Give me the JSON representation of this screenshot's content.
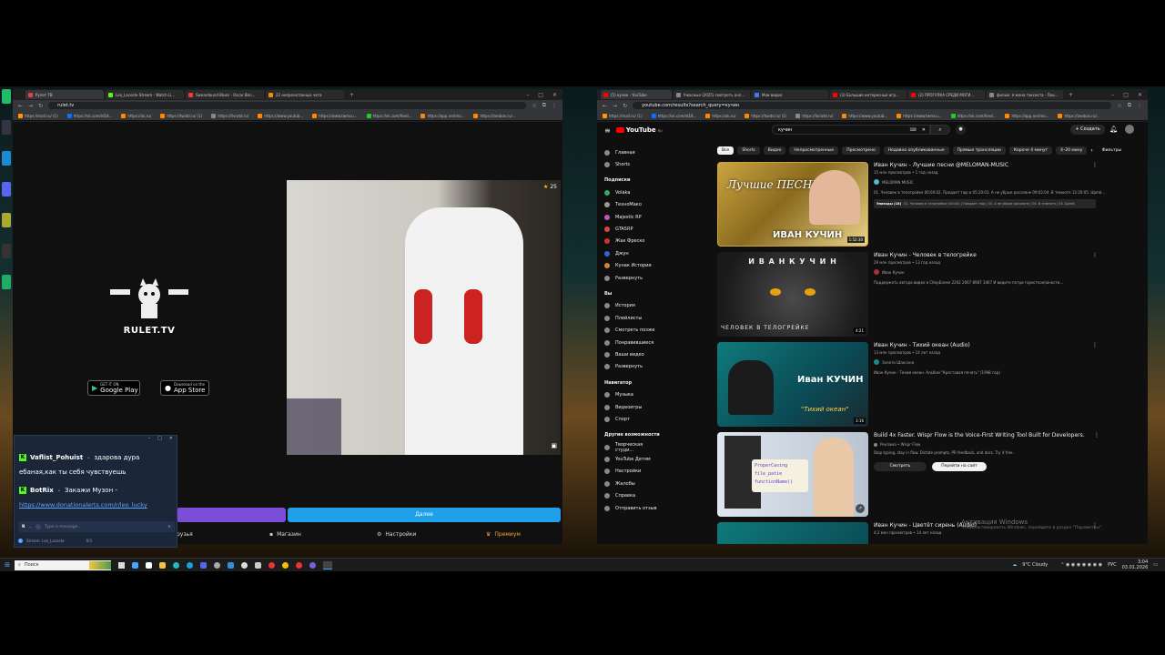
{
  "desktop": {
    "icons": [
      "",
      "",
      "",
      "",
      "",
      "",
      ""
    ]
  },
  "left_browser": {
    "tabs": [
      {
        "label": "Рулет ТВ",
        "color": "#e04040"
      },
      {
        "label": "Leo_Lacoste Stream - Watch Li...",
        "color": "#53fc18"
      },
      {
        "label": "Sweardound Blues - Oscar Ben...",
        "color": "#ff3333"
      },
      {
        "label": "22 непрочитанных чата",
        "color": "#f08c00"
      }
    ],
    "url": "rulet.tv",
    "bookmarks": [
      "https://mail.ru/ (1)",
      "https://vk.com/id18...",
      "https://ok.ru/",
      "https://twidd.ru/ (1)",
      "https://livratd.ru/",
      "https://www.youtub...",
      "https://www.twmcu...",
      "https://vk.com/feed...",
      "https://app.nerimo...",
      "https://zeebox.ru/..."
    ],
    "site": {
      "logo_text": "RULET.TV",
      "google_play": {
        "small": "GET IT ON",
        "big": "Google Play"
      },
      "app_store": {
        "small": "Download on the",
        "big": "App Store"
      },
      "viewer_count": "25",
      "next_button": "Далее",
      "nav": {
        "friends": "рузья",
        "shop": "Магазин",
        "settings": "Настройки",
        "premium": "Премиум"
      }
    }
  },
  "chat_popup": {
    "messages": [
      {
        "user": "Vaflist_Pohuist",
        "text": "здарова дура"
      },
      {
        "user": "",
        "text": "ебаная,как ты себя чувствуешь"
      },
      {
        "user": "BotRix",
        "text": "Закажи Музон -"
      },
      {
        "user": "",
        "text": "https://www.donationalerts.com/r/leo_lucky"
      }
    ],
    "input_placeholder": "Type a message...",
    "footer_label": "Stream: Leo_Lacoste",
    "footer_count": "0/3"
  },
  "right_browser": {
    "tabs": [
      {
        "label": "(5) кучин - YouTube",
        "color": "#ff0000"
      },
      {
        "label": "Ужасные (2025) смотреть онл...",
        "color": "#888888"
      },
      {
        "label": "Мои видео",
        "color": "#3d7aff"
      },
      {
        "label": "(3) Большие интересные игр...",
        "color": "#ff0000"
      },
      {
        "label": "(2) ПРОГУЛКА СРЕДИ МОГИ...",
        "color": "#ff0000"
      },
      {
        "label": "фильм: я жена таксиста - Пои...",
        "color": "#888888"
      }
    ],
    "url": "youtube.com/results?search_query=кучин",
    "bookmarks": [
      "https://mail.ru/ (1)",
      "https://vk.com/id18...",
      "https://ok.ru/",
      "https://twidd.ru/ (1)",
      "https://livratd.ru/",
      "https://www.youtub...",
      "https://www.twmcu...",
      "https://vk.com/feed...",
      "https://app.nerimo...",
      "https://zeebox.ru/..."
    ],
    "youtube": {
      "logo": "YouTube",
      "logo_suffix": "RU",
      "search_value": "кучин",
      "create_button": "Создать",
      "sidebar": [
        {
          "label": "Главная",
          "icon": "home-icon"
        },
        {
          "label": "Shorts",
          "icon": "shorts-icon"
        },
        {
          "label": "Подписки",
          "icon": "",
          "section": true
        },
        {
          "label": "Volaka",
          "icon": "channel"
        },
        {
          "label": "ТехноМако",
          "icon": "channel"
        },
        {
          "label": "Majestic RP",
          "icon": "channel"
        },
        {
          "label": "GTA5RP",
          "icon": "channel"
        },
        {
          "label": "Жак Фреско",
          "icon": "channel"
        },
        {
          "label": "Джун",
          "icon": "channel"
        },
        {
          "label": "Кунак Истории",
          "icon": "channel"
        },
        {
          "label": "Развернуть",
          "icon": "chevron-down-icon"
        },
        {
          "label": "Вы",
          "icon": "",
          "section": true
        },
        {
          "label": "История",
          "icon": "history-icon"
        },
        {
          "label": "Плейлисты",
          "icon": "playlist-icon"
        },
        {
          "label": "Смотреть позже",
          "icon": "clock-icon"
        },
        {
          "label": "Понравившиеся",
          "icon": "like-icon"
        },
        {
          "label": "Ваши видео",
          "icon": "video-icon"
        },
        {
          "label": "Развернуть",
          "icon": "chevron-down-icon"
        },
        {
          "label": "Навигатор",
          "icon": "",
          "section": true
        },
        {
          "label": "Музыка",
          "icon": "music-icon"
        },
        {
          "label": "Видеоигры",
          "icon": "game-icon"
        },
        {
          "label": "Спорт",
          "icon": "sport-icon"
        },
        {
          "label": "Другие возможности",
          "icon": "",
          "section": true
        },
        {
          "label": "Творческая студи...",
          "icon": "studio-icon"
        },
        {
          "label": "YouTube Детям",
          "icon": "kids-icon"
        },
        {
          "label": "Настройки",
          "icon": "gear-icon"
        },
        {
          "label": "Жалобы",
          "icon": "flag-icon"
        },
        {
          "label": "Справка",
          "icon": "help-icon"
        },
        {
          "label": "Отправить отзыв",
          "icon": "feedback-icon"
        }
      ],
      "chips": [
        "Все",
        "Shorts",
        "Видео",
        "Непросмотренные",
        "Просмотрено",
        "Недавно опубликованные",
        "Прямые трансляции",
        "Короче 4 минут",
        "4–20 мину"
      ],
      "filters_label": "Фильтры",
      "results": [
        {
          "title": "Иван Кучин - Лучшие песни @MELOMAN-MUSIC",
          "meta": "15 млн просмотров • 1 год назад",
          "channel": "MELOMAN MUSIC",
          "desc": "01. Человек в телогрейке 00:00:02. Предает тюр в 05:20:03. А не убрые россияне 09:02:04. В темноте 12:20:05. Щепй ...",
          "episodes": "Эпизоды (18)",
          "episodes_text": "01. Человек в телогрейке (00:00) | Предает тюр | 03. А не убрые россияне | 04. В темноте | 05. Щепй",
          "duration": "1:52:30",
          "thumb_text_top": "Лучшие ПЕСНИ",
          "thumb_text_bottom": "ИВАН КУЧИН"
        },
        {
          "title": "Иван Кучин - Человек в телогрейке",
          "meta": "29 млн просмотров • 13 год назад",
          "channel": "Иван Кучин",
          "desc": "Поддержать автора видео в СберБанке 2202 2067 8987 3467 И видите потри горесткое(юности...",
          "duration": "4:21",
          "thumb_text_top": "И В А Н   К У Ч И Н",
          "thumb_text_bottom": "ЧЕЛОВЕК В ТЕЛОГРЕЙКЕ"
        },
        {
          "title": "Иван Кучин - Тихий океан (Audio)",
          "meta": "13 млн просмотров • 14 лет назад",
          "channel": "Золото Шансона",
          "desc": "Иван Кучин - Тихий океан. Альбом \"Крестовая печать\" (1998 год)",
          "duration": "3:16",
          "thumb_text_top": "Иван КУЧИН",
          "thumb_text_bottom": "\"Тихий океан\""
        },
        {
          "title": "Build 4x Faster. Wispr Flow is the Voice-First Writing Tool Built for Developers.",
          "meta": "",
          "channel": "Реклама • Wispr Flow",
          "desc": "Stop typing, stay in flow. Dictate prompts, PR feedback, and docs. Try it free.",
          "btn1": "Смотреть",
          "btn2": "Перейти на сайт",
          "thumb_lines": [
            "ProperCasing",
            "file_patie",
            "functionName()"
          ]
        },
        {
          "title": "Иван Кучин - Цветёт сирень (Audio)",
          "meta": "4,2 млн просмотров • 14 лет назад",
          "channel": "Золото Шансона"
        }
      ]
    }
  },
  "watermark": {
    "line1": "Активация Windows",
    "line2": "Чтобы активировать Windows, перейдите в раздел \"Параметры\"."
  },
  "taskbar": {
    "search_placeholder": "Поиск",
    "weather": "9°C Cloudy",
    "lang": "РУС",
    "time": "3:04",
    "date": "03.01.2026"
  }
}
